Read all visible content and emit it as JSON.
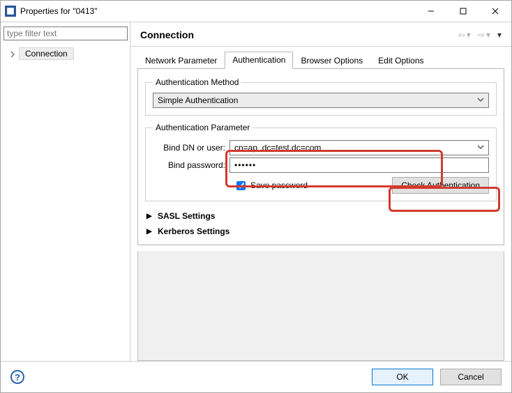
{
  "window": {
    "title": "Properties for \"0413\""
  },
  "left": {
    "filter_placeholder": "type filter text",
    "tree_item": "Connection"
  },
  "header": {
    "title": "Connection"
  },
  "tabs": {
    "network": "Network Parameter",
    "auth": "Authentication",
    "browser": "Browser Options",
    "edit": "Edit Options"
  },
  "auth_method": {
    "legend": "Authentication Method",
    "value": "Simple Authentication"
  },
  "auth_param": {
    "legend": "Authentication Parameter",
    "bind_dn_label": "Bind DN or user:",
    "bind_dn_value": "cn=ap ,dc=test,dc=com",
    "bind_pw_label": "Bind password:",
    "bind_pw_masked": "••••••",
    "save_pw_label": "Save password",
    "check_btn": "Check Authentication"
  },
  "sections": {
    "sasl": "SASL Settings",
    "kerberos": "Kerberos Settings"
  },
  "buttons": {
    "ok": "OK",
    "cancel": "Cancel"
  }
}
